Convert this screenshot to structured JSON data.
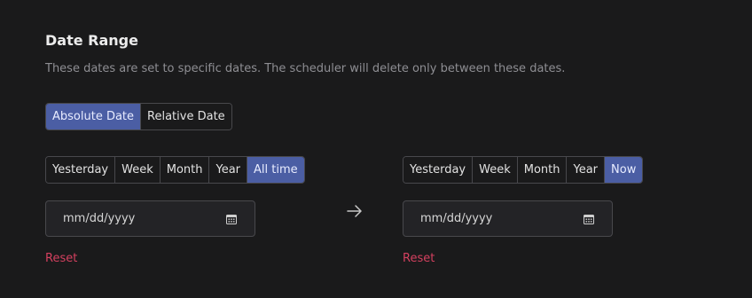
{
  "section": {
    "title": "Date Range",
    "description": "These dates are set to specific dates. The scheduler will delete only between these dates."
  },
  "mode_toggle": {
    "options": [
      "Absolute Date",
      "Relative Date"
    ],
    "selected": "Absolute Date"
  },
  "start": {
    "presets": [
      "Yesterday",
      "Week",
      "Month",
      "Year",
      "All time"
    ],
    "selected": "All time",
    "date_placeholder": "mm/dd/yyyy",
    "reset_label": "Reset"
  },
  "end": {
    "presets": [
      "Yesterday",
      "Week",
      "Month",
      "Year",
      "Now"
    ],
    "selected": "Now",
    "date_placeholder": "mm/dd/yyyy",
    "reset_label": "Reset"
  },
  "colors": {
    "background": "#1a1a1b",
    "accent": "#4b5ea4",
    "danger": "#d4405f"
  },
  "icons": {
    "calendar": "calendar-icon",
    "arrow": "arrow-right-icon"
  }
}
